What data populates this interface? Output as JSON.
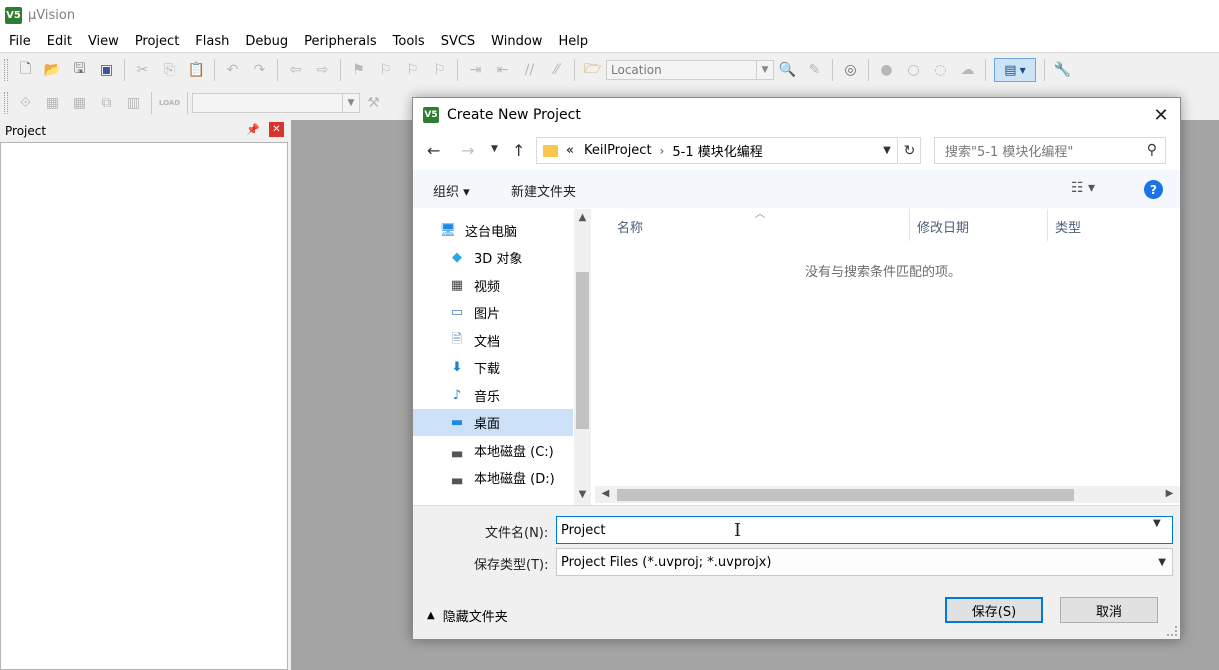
{
  "app": {
    "title": "µVision",
    "logo_text": "V5"
  },
  "menu": [
    "File",
    "Edit",
    "View",
    "Project",
    "Flash",
    "Debug",
    "Peripherals",
    "Tools",
    "SVCS",
    "Window",
    "Help"
  ],
  "toolbar": {
    "location_label": "Location",
    "load_label": "LOAD"
  },
  "project_panel": {
    "title": "Project"
  },
  "dialog": {
    "title": "Create New Project",
    "breadcrumb": {
      "prefix": "«",
      "parts": [
        "KeilProject",
        "5-1 模块化编程"
      ]
    },
    "search_placeholder": "搜索\"5-1 模块化编程\"",
    "commands": {
      "organize": "组织 ▾",
      "new_folder": "新建文件夹"
    },
    "tree": [
      {
        "label": "这台电脑",
        "icon": "computer-icon"
      },
      {
        "label": "3D 对象",
        "icon": "cube-3d-icon"
      },
      {
        "label": "视频",
        "icon": "video-icon"
      },
      {
        "label": "图片",
        "icon": "picture-icon"
      },
      {
        "label": "文档",
        "icon": "document-icon"
      },
      {
        "label": "下载",
        "icon": "download-icon"
      },
      {
        "label": "音乐",
        "icon": "music-icon"
      },
      {
        "label": "桌面",
        "icon": "desktop-icon",
        "selected": true
      },
      {
        "label": "本地磁盘 (C:)",
        "icon": "drive-icon"
      },
      {
        "label": "本地磁盘 (D:)",
        "icon": "drive-icon"
      }
    ],
    "columns": [
      "名称",
      "修改日期",
      "类型"
    ],
    "empty_message": "没有与搜索条件匹配的项。",
    "filename_label": "文件名(N):",
    "filename_value": "Project",
    "filetype_label": "保存类型(T):",
    "filetype_value": "Project Files (*.uvproj; *.uvprojx)",
    "hide_folders_label": "隐藏文件夹",
    "save_button": "保存(S)",
    "cancel_button": "取消"
  },
  "colors": {
    "accent": "#0078d7",
    "workspace": "#a4a4a4",
    "selected_tree": "#cce0f7"
  }
}
